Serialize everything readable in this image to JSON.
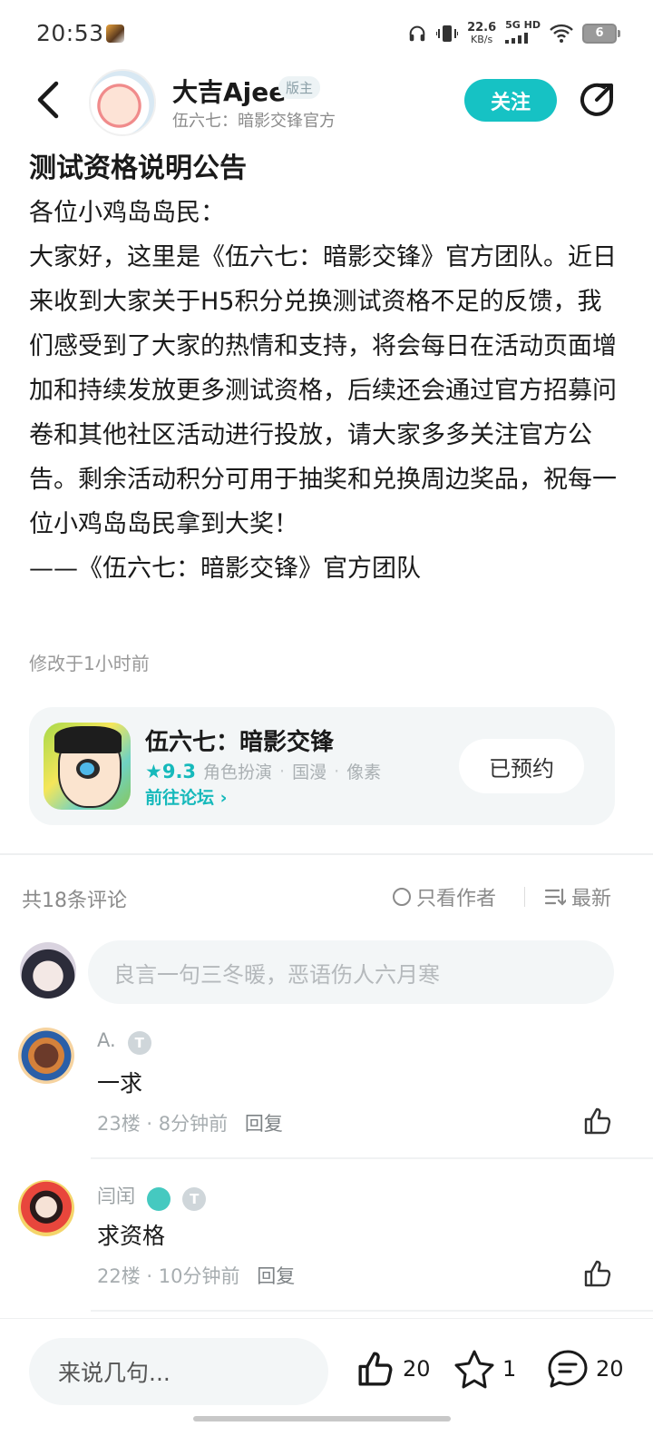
{
  "status_bar": {
    "time": "20:53",
    "net_speed_value": "22.6",
    "net_speed_unit": "KB/s",
    "network_type": "5G HD",
    "battery": "6"
  },
  "header": {
    "author_name": "大吉Ajee",
    "author_badge": "版主",
    "author_sub": "伍六七：暗影交锋官方",
    "follow_label": "关注"
  },
  "article": {
    "title": "测试资格说明公告",
    "greeting": "各位小鸡岛岛民：",
    "body": "大家好，这里是《伍六七：暗影交锋》官方团队。近日来收到大家关于H5积分兑换测试资格不足的反馈，我们感受到了大家的热情和支持，将会每日在活动页面增加和持续发放更多测试资格，后续还会通过官方招募问卷和其他社区活动进行投放，请大家多多关注官方公告。剩余活动积分可用于抽奖和兑换周边奖品，祝每一位小鸡岛岛民拿到大奖！",
    "signature": "——《伍六七：暗影交锋》官方团队",
    "modified": "修改于1小时前"
  },
  "game_card": {
    "name": "伍六七：暗影交锋",
    "rating": "9.3",
    "tags": [
      "角色扮演",
      "国漫",
      "像素"
    ],
    "forum_link": "前往论坛",
    "reserve_label": "已预约"
  },
  "comments": {
    "count_label": "共18条评论",
    "only_author_label": "只看作者",
    "sort_label": "最新",
    "input_placeholder": "良言一句三冬暖，恶语伤人六月寒",
    "items": [
      {
        "user": "A.",
        "text": "一求",
        "floor": "23楼",
        "time": "8分钟前",
        "reply": "回复"
      },
      {
        "user": "闫闰",
        "text": "求资格",
        "floor": "22楼",
        "time": "10分钟前",
        "reply": "回复"
      }
    ]
  },
  "bottom_bar": {
    "input_placeholder": "来说几句...",
    "likes": "20",
    "favorites": "1",
    "comments": "20"
  },
  "colors": {
    "accent": "#16c2c4",
    "accent_text": "#16b9bb",
    "muted": "#8a8a8a"
  }
}
